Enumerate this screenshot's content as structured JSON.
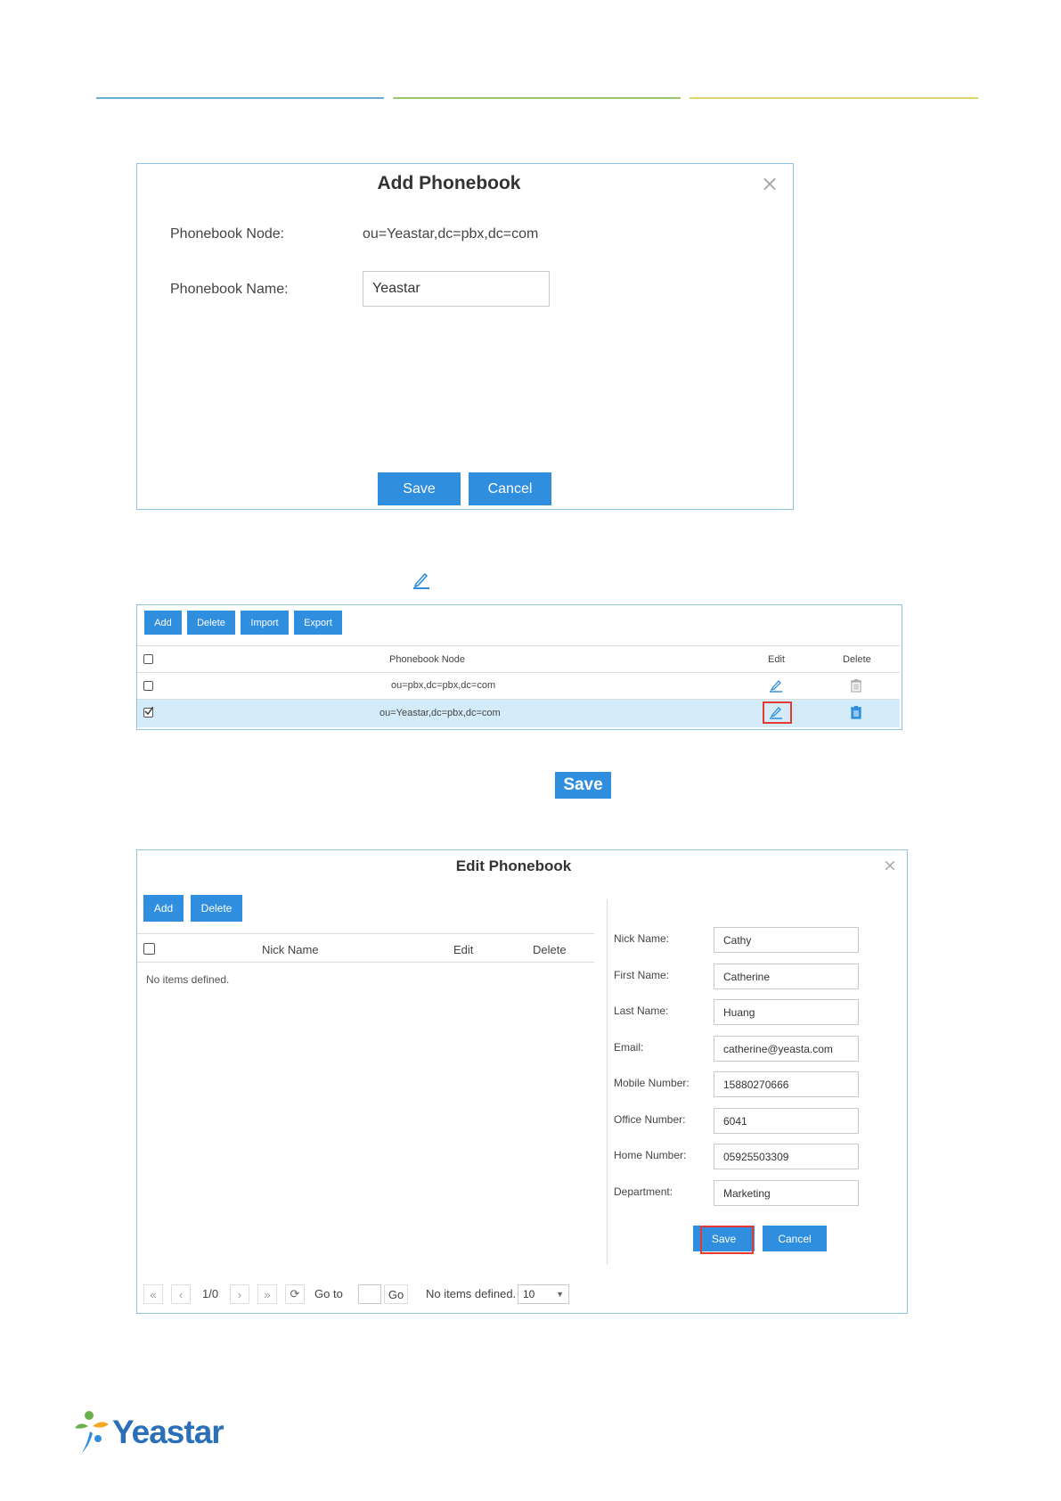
{
  "add_phonebook": {
    "title": "Add Phonebook",
    "node_label": "Phonebook Node:",
    "node_value": "ou=Yeastar,dc=pbx,dc=com",
    "name_label": "Phonebook Name:",
    "name_value": "Yeastar",
    "save_label": "Save",
    "cancel_label": "Cancel"
  },
  "phonebook_list": {
    "toolbar": [
      "Add",
      "Delete",
      "Import",
      "Export"
    ],
    "columns": {
      "node": "Phonebook Node",
      "edit": "Edit",
      "delete": "Delete"
    },
    "rows": [
      {
        "node": "ou=pbx,dc=pbx,dc=com",
        "checked": false
      },
      {
        "node": "ou=Yeastar,dc=pbx,dc=com",
        "checked": true
      }
    ]
  },
  "inline_save_label": "Save",
  "edit_phonebook": {
    "title": "Edit Phonebook",
    "add_label": "Add",
    "delete_label": "Delete",
    "columns": {
      "nick": "Nick Name",
      "edit": "Edit",
      "delete": "Delete"
    },
    "empty_text": "No items defined.",
    "fields": [
      {
        "label": "Nick Name:",
        "value": "Cathy"
      },
      {
        "label": "First Name:",
        "value": "Catherine"
      },
      {
        "label": "Last Name:",
        "value": "Huang"
      },
      {
        "label": "Email:",
        "value": "catherine@yeasta.com"
      },
      {
        "label": "Mobile Number:",
        "value": "15880270666"
      },
      {
        "label": "Office Number:",
        "value": "6041"
      },
      {
        "label": "Home Number:",
        "value": "05925503309"
      },
      {
        "label": "Department:",
        "value": "Marketing"
      }
    ],
    "save_label": "Save",
    "cancel_label": "Cancel",
    "pager": {
      "page": "1/0",
      "goto_label": "Go to",
      "go_label": "Go",
      "status": "No items defined.",
      "page_size": "10"
    }
  },
  "footer": {
    "brand": "Yeastar"
  },
  "colors": {
    "accent_blue": "#2f8ede",
    "panel_border": "#8fc3e3",
    "highlight_row": "#d4ebfa",
    "red_box": "#e53935",
    "line_blue": "#6aaed6",
    "line_green": "#9cc76d",
    "line_yellow": "#e4d56b"
  }
}
